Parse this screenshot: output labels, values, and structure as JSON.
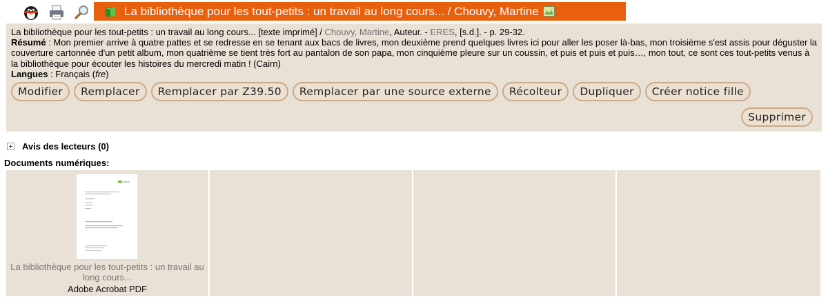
{
  "header": {
    "title": "La bibliothèque pour les tout-petits : un travail au long cours... / Chouvy, Martine",
    "icons": [
      "tux-icon",
      "printer-icon",
      "magnifier-icon",
      "book-icon",
      "image-icon"
    ],
    "tab_color": "#e8600e"
  },
  "notice": {
    "ref_title": "La bibliothèque pour les tout-petits : un travail au long cours... [texte imprimé] / ",
    "author": "Chouvy, Martine",
    "author_role": ", Auteur. - ",
    "publisher": "ERES",
    "ref_tail": ", [s.d.]. - p. 29-32.",
    "resume_label": "Résumé",
    "resume_text": " : Mon premier arrive à quatre pattes et se redresse en se tenant aux bacs de livres, mon deuxième prend quelques livres ici pour aller les poser là-bas, mon troisième s'est assis pour déguster la couverture cartonnée d'un petit album, mon quatrième se tient très fort au pantalon de son papa, mon cinquième pleure sur un coussin, et puis et puis et puis…, mon tout, ce sont ces tout-petits venus à la bibliothèque pour écouter les histoires du mercredi matin ! (Cairn)",
    "langues_label": "Langues",
    "langues_value": " : Français (",
    "langues_code": "fre",
    "langues_close": ")"
  },
  "buttons": {
    "modifier": "Modifier",
    "remplacer": "Remplacer",
    "remplacer_z3950": "Remplacer par Z39.50",
    "remplacer_source": "Remplacer par une source externe",
    "recolteur": "Récolteur",
    "dupliquer": "Dupliquer",
    "creer_fille": "Créer notice fille",
    "supprimer": "Supprimer"
  },
  "avis": {
    "label": "Avis des lecteurs (0)"
  },
  "documents": {
    "heading": "Documents numériques:",
    "items": [
      {
        "title": "La bibliothèque pour les tout-petits : un travail au long cours...",
        "type": "Adobe Acrobat PDF"
      }
    ]
  },
  "colors": {
    "panel_bg": "#e9e1d6",
    "button_border": "#c9a98b",
    "link_grey": "#707070"
  }
}
